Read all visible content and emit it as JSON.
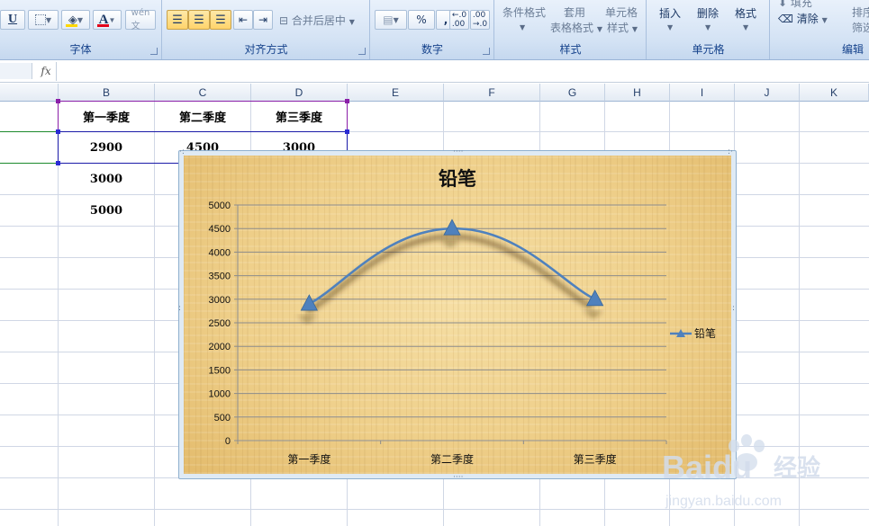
{
  "ribbon": {
    "groups": {
      "font": "字体",
      "alignment": "对齐方式",
      "number": "数字",
      "styles": "样式",
      "cells": "单元格",
      "editing": "编辑"
    },
    "buttons": {
      "underline": "U",
      "merge_center": "合并后居中",
      "percent": "%",
      "comma": ",",
      "increase_decimal": ".0→.00",
      "decrease_decimal": ".00→.0",
      "conditional_format": "条件格式",
      "format_table_line1": "套用",
      "format_table_line2": "表格格式",
      "cell_styles_line1": "单元格",
      "cell_styles_line2": "样式",
      "insert": "插入",
      "delete": "删除",
      "format": "格式",
      "fill": "填充",
      "clear": "清除",
      "sort_line1": "排序",
      "sort_line2": "筛选"
    },
    "colors": {
      "fill_color": "#ffd800",
      "font_color": "#e2001a"
    }
  },
  "formula_bar": {
    "fx_label": "fx",
    "value": ""
  },
  "sheet": {
    "columns": [
      "B",
      "C",
      "D",
      "E",
      "F",
      "G",
      "H",
      "I",
      "J",
      "K"
    ],
    "header_row": [
      "第一季度",
      "第二季度",
      "第三季度"
    ],
    "rows": [
      [
        "2900",
        "4500",
        "3000"
      ],
      [
        "3000",
        "",
        ""
      ],
      [
        "5000",
        "",
        ""
      ]
    ]
  },
  "chart_data": {
    "type": "line",
    "title": "铅笔",
    "categories": [
      "第一季度",
      "第二季度",
      "第三季度"
    ],
    "series": [
      {
        "name": "铅笔",
        "values": [
          2900,
          4500,
          3000
        ],
        "color": "#4f81bd",
        "marker": "triangle",
        "smooth": true
      }
    ],
    "ylim": [
      0,
      5000
    ],
    "yticks": [
      0,
      500,
      1000,
      1500,
      2000,
      2500,
      3000,
      3500,
      4000,
      4500,
      5000
    ],
    "grid": true,
    "legend": "right",
    "background": "papyrus texture"
  },
  "watermark": {
    "brand": "Baidu",
    "cn_text": "经验",
    "url": "jingyan.baidu.com"
  }
}
